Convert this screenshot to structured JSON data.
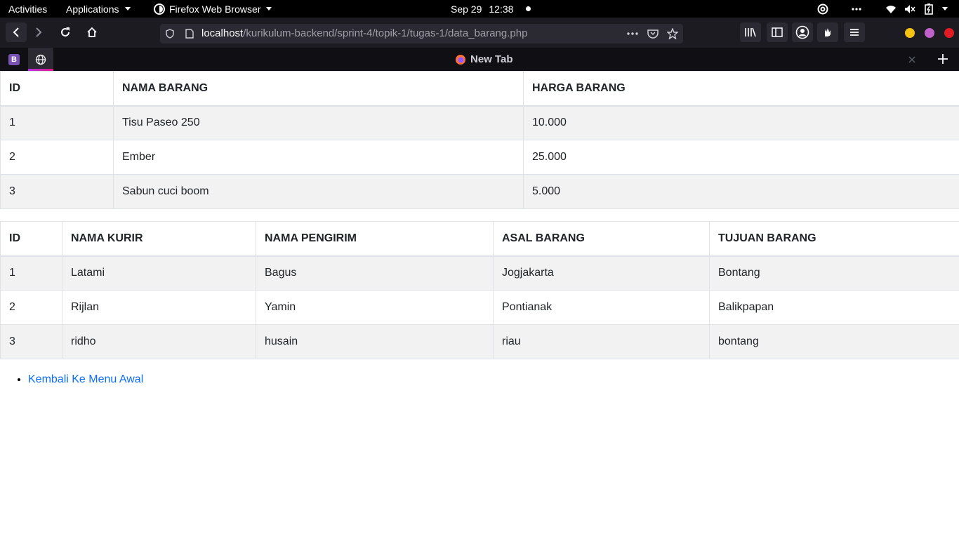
{
  "system_bar": {
    "activities": "Activities",
    "applications": "Applications",
    "app_name": "Firefox Web Browser",
    "date": "Sep 29",
    "time": "12:38"
  },
  "browser": {
    "url_host": "localhost",
    "url_path": "/kurikulum-backend/sprint-4/topik-1/tugas-1/data_barang.php",
    "pinned_tab_letter": "B",
    "active_tab_title": "New Tab",
    "window_colors": {
      "minimize": "#f5c211",
      "maximize": "#c061cb",
      "close": "#e01b24"
    }
  },
  "table_barang": {
    "headers": [
      "ID",
      "NAMA BARANG",
      "HARGA BARANG"
    ],
    "rows": [
      [
        "1",
        "Tisu Paseo 250",
        "10.000"
      ],
      [
        "2",
        "Ember",
        "25.000"
      ],
      [
        "3",
        "Sabun cuci boom",
        "5.000"
      ]
    ]
  },
  "table_kurir": {
    "headers": [
      "ID",
      "NAMA KURIR",
      "NAMA PENGIRIM",
      "ASAL BARANG",
      "TUJUAN BARANG"
    ],
    "rows": [
      [
        "1",
        "Latami",
        "Bagus",
        "Jogjakarta",
        "Bontang"
      ],
      [
        "2",
        "Rijlan",
        "Yamin",
        "Pontianak",
        "Balikpapan"
      ],
      [
        "3",
        "ridho",
        "husain",
        "riau",
        "bontang"
      ]
    ]
  },
  "links": {
    "back": "Kembali Ke Menu Awal"
  }
}
